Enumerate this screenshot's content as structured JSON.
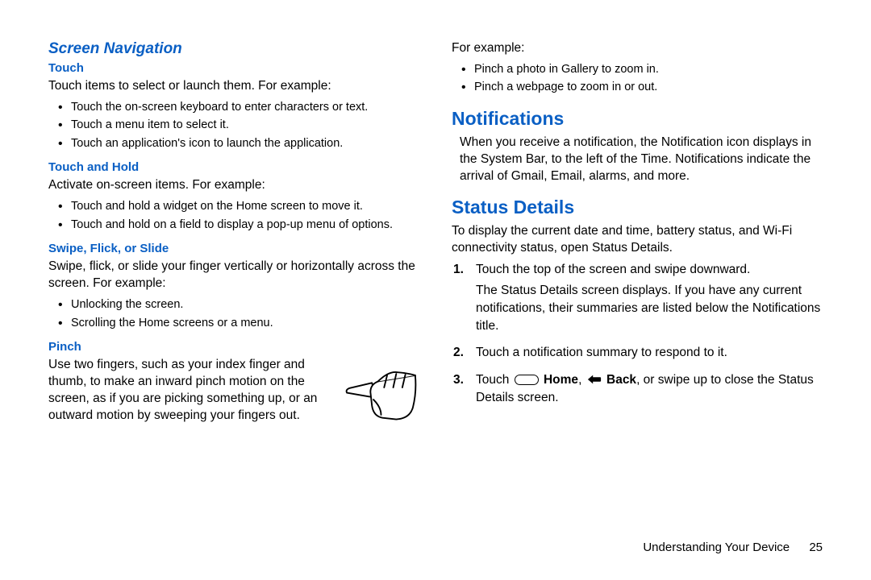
{
  "left": {
    "section": "Screen Navigation",
    "touch": {
      "heading": "Touch",
      "intro": "Touch items to select or launch them. For example:",
      "bullets": [
        "Touch the on-screen keyboard to enter characters or text.",
        "Touch a menu item to select it.",
        "Touch an application's icon to launch the application."
      ]
    },
    "touchHold": {
      "heading": "Touch and Hold",
      "intro": "Activate on-screen items. For example:",
      "bullets": [
        "Touch and hold a widget on the Home screen to move it.",
        "Touch and hold on a field to display a pop-up menu of options."
      ]
    },
    "swipe": {
      "heading": "Swipe, Flick, or Slide",
      "intro": "Swipe, flick, or slide your finger vertically or horizontally across the screen. For example:",
      "bullets": [
        "Unlocking the screen.",
        "Scrolling the Home screens or a menu."
      ]
    },
    "pinch": {
      "heading": "Pinch",
      "text": "Use two fingers, such as your index finger and thumb, to make an inward pinch motion on the screen, as if you are picking something up, or an outward motion by sweeping your fingers out."
    }
  },
  "right": {
    "forExample": "For example:",
    "pinchBullets": [
      "Pinch a photo in Gallery to zoom in.",
      "Pinch a webpage to zoom in or out."
    ],
    "notifications": {
      "heading": "Notifications",
      "text": "When you receive a notification, the Notification icon displays in the System Bar, to the left of the Time. Notifications indicate the arrival of Gmail, Email, alarms, and more."
    },
    "status": {
      "heading": "Status Details",
      "intro": "To display the current date and time, battery status, and Wi-Fi connectivity status, open Status Details.",
      "steps": [
        {
          "num": "1.",
          "text": "Touch the top of the screen and swipe downward.",
          "sub": "The Status Details screen displays. If you have any current notifications, their summaries are listed below the Notifications title."
        },
        {
          "num": "2.",
          "text": "Touch a notification summary to respond to it."
        },
        {
          "num": "3.",
          "text_pre": "Touch ",
          "home": "Home",
          "sep": ", ",
          "back": "Back",
          "text_post": ", or swipe up to close the Status Details screen."
        }
      ]
    }
  },
  "footer": {
    "chapter": "Understanding Your Device",
    "page": "25"
  }
}
